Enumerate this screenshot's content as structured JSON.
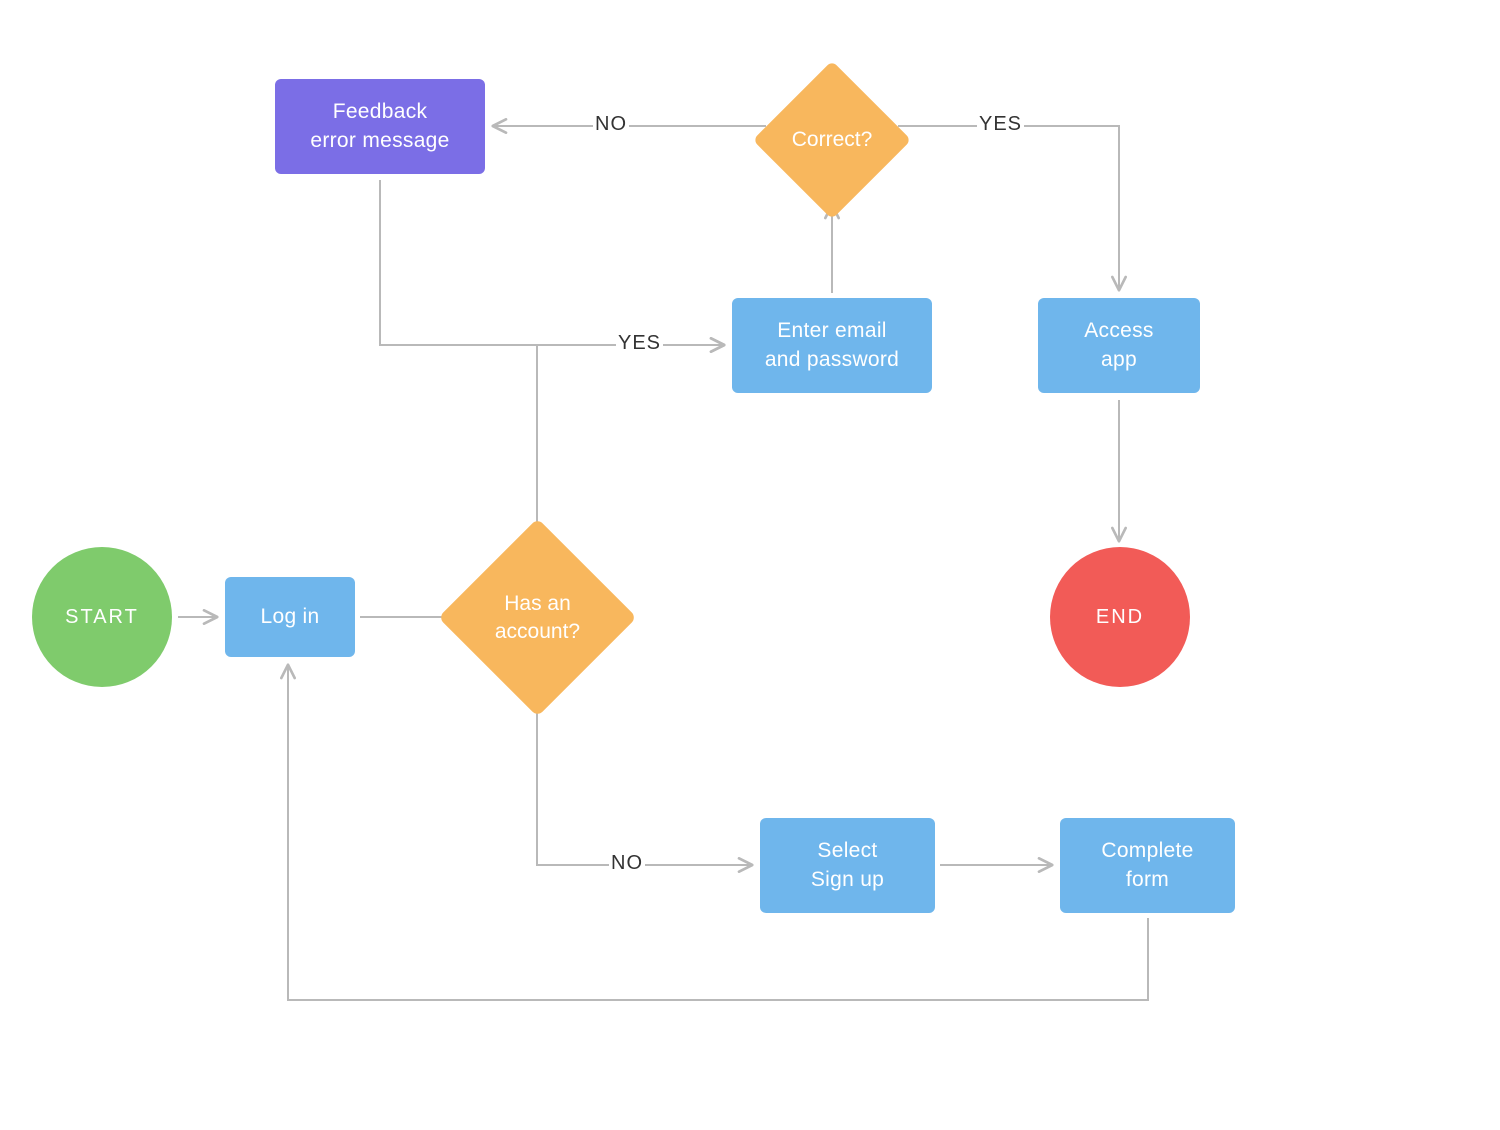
{
  "nodes": {
    "start": {
      "label": "START",
      "type": "terminator",
      "color": "#7fcb6c"
    },
    "login": {
      "label": "Log in",
      "type": "process",
      "color": "#6fb6ec"
    },
    "hasacct": {
      "line1": "Has an",
      "line2": "account?",
      "type": "decision",
      "color": "#f8b75d"
    },
    "feedback": {
      "line1": "Feedback",
      "line2": "error message",
      "type": "process",
      "color": "#7b6ee6"
    },
    "enter": {
      "line1": "Enter email",
      "line2": "and password",
      "type": "process",
      "color": "#6fb6ec"
    },
    "correct": {
      "label": "Correct?",
      "type": "decision",
      "color": "#f8b75d"
    },
    "access": {
      "line1": "Access",
      "line2": "app",
      "type": "process",
      "color": "#6fb6ec"
    },
    "end": {
      "label": "END",
      "type": "terminator",
      "color": "#f25b57"
    },
    "signup": {
      "line1": "Select",
      "line2": "Sign up",
      "type": "process",
      "color": "#6fb6ec"
    },
    "form": {
      "line1": "Complete",
      "line2": "form",
      "type": "process",
      "color": "#6fb6ec"
    }
  },
  "edgeLabels": {
    "hasacct_yes": "YES",
    "hasacct_no": "NO",
    "correct_yes": "YES",
    "correct_no": "NO"
  },
  "edges": [
    {
      "from": "start",
      "to": "login"
    },
    {
      "from": "login",
      "to": "hasacct"
    },
    {
      "from": "hasacct",
      "to": "enter",
      "label": "YES"
    },
    {
      "from": "hasacct",
      "to": "signup",
      "label": "NO"
    },
    {
      "from": "enter",
      "to": "correct"
    },
    {
      "from": "correct",
      "to": "feedback",
      "label": "NO"
    },
    {
      "from": "correct",
      "to": "access",
      "label": "YES"
    },
    {
      "from": "feedback",
      "to": "enter"
    },
    {
      "from": "access",
      "to": "end"
    },
    {
      "from": "signup",
      "to": "form"
    },
    {
      "from": "form",
      "to": "login"
    }
  ]
}
